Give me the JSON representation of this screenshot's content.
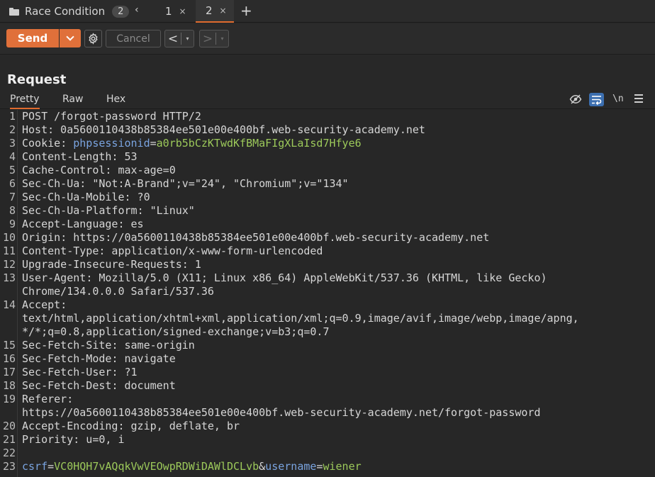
{
  "tabbar": {
    "group_label": "Race Condition",
    "group_count": "2",
    "group_caret": "‹",
    "tabs": [
      {
        "label": "1",
        "close": "×"
      },
      {
        "label": "2",
        "close": "×"
      }
    ],
    "add": "+"
  },
  "toolbar": {
    "send_label": "Send",
    "cancel_label": "Cancel",
    "back_arrow": "<",
    "forward_arrow": ">",
    "dropdown_glyph": "▾"
  },
  "panel": {
    "title": "Request",
    "tabs": [
      "Pretty",
      "Raw",
      "Hex"
    ],
    "newline_label": "\\n"
  },
  "lines": [
    {
      "n": "1",
      "t": "POST /forgot-password HTTP/2"
    },
    {
      "n": "2",
      "k": "Host",
      "v": " 0a5600110438b85384ee501e00e400bf.web-security-academy.net"
    },
    {
      "n": "3",
      "k": "Cookie",
      "ck": "phpsessionid",
      "cv": "a0rb5bCzKTwdKfBMaFIgXLaIsd7Hfye6"
    },
    {
      "n": "4",
      "k": "Content-Length",
      "v": " 53"
    },
    {
      "n": "5",
      "k": "Cache-Control",
      "v": " max-age=0"
    },
    {
      "n": "6",
      "k": "Sec-Ch-Ua",
      "v": " \"Not:A-Brand\";v=\"24\", \"Chromium\";v=\"134\""
    },
    {
      "n": "7",
      "k": "Sec-Ch-Ua-Mobile",
      "v": " ?0"
    },
    {
      "n": "8",
      "k": "Sec-Ch-Ua-Platform",
      "v": " \"Linux\""
    },
    {
      "n": "9",
      "k": "Accept-Language",
      "v": " es"
    },
    {
      "n": "10",
      "k": "Origin",
      "v": " https://0a5600110438b85384ee501e00e400bf.web-security-academy.net"
    },
    {
      "n": "11",
      "k": "Content-Type",
      "v": " application/x-www-form-urlencoded"
    },
    {
      "n": "12",
      "k": "Upgrade-Insecure-Requests",
      "v": " 1"
    },
    {
      "n": "13",
      "k": "User-Agent",
      "v": " Mozilla/5.0 (X11; Linux x86_64) AppleWebKit/537.36 (KHTML, like Gecko)"
    },
    {
      "n": "",
      "t": "Chrome/134.0.0.0 Safari/537.36"
    },
    {
      "n": "14",
      "k": "Accept",
      "v": ""
    },
    {
      "n": "",
      "t": "text/html,application/xhtml+xml,application/xml;q=0.9,image/avif,image/webp,image/apng,"
    },
    {
      "n": "",
      "t": "*/*;q=0.8,application/signed-exchange;v=b3;q=0.7"
    },
    {
      "n": "15",
      "k": "Sec-Fetch-Site",
      "v": " same-origin"
    },
    {
      "n": "16",
      "k": "Sec-Fetch-Mode",
      "v": " navigate"
    },
    {
      "n": "17",
      "k": "Sec-Fetch-User",
      "v": " ?1"
    },
    {
      "n": "18",
      "k": "Sec-Fetch-Dest",
      "v": " document"
    },
    {
      "n": "19",
      "k": "Referer",
      "v": ""
    },
    {
      "n": "",
      "t": "https://0a5600110438b85384ee501e00e400bf.web-security-academy.net/forgot-password"
    },
    {
      "n": "20",
      "k": "Accept-Encoding",
      "v": " gzip, deflate, br"
    },
    {
      "n": "21",
      "k": "Priority",
      "v": " u=0, i"
    },
    {
      "n": "22",
      "t": ""
    },
    {
      "n": "23",
      "body": [
        {
          "k": "csrf",
          "v": "VC0HQH7vAQqkVwVEOwpRDWiDAWlDCLvb"
        },
        {
          "k": "username",
          "v": "wiener"
        }
      ]
    }
  ]
}
